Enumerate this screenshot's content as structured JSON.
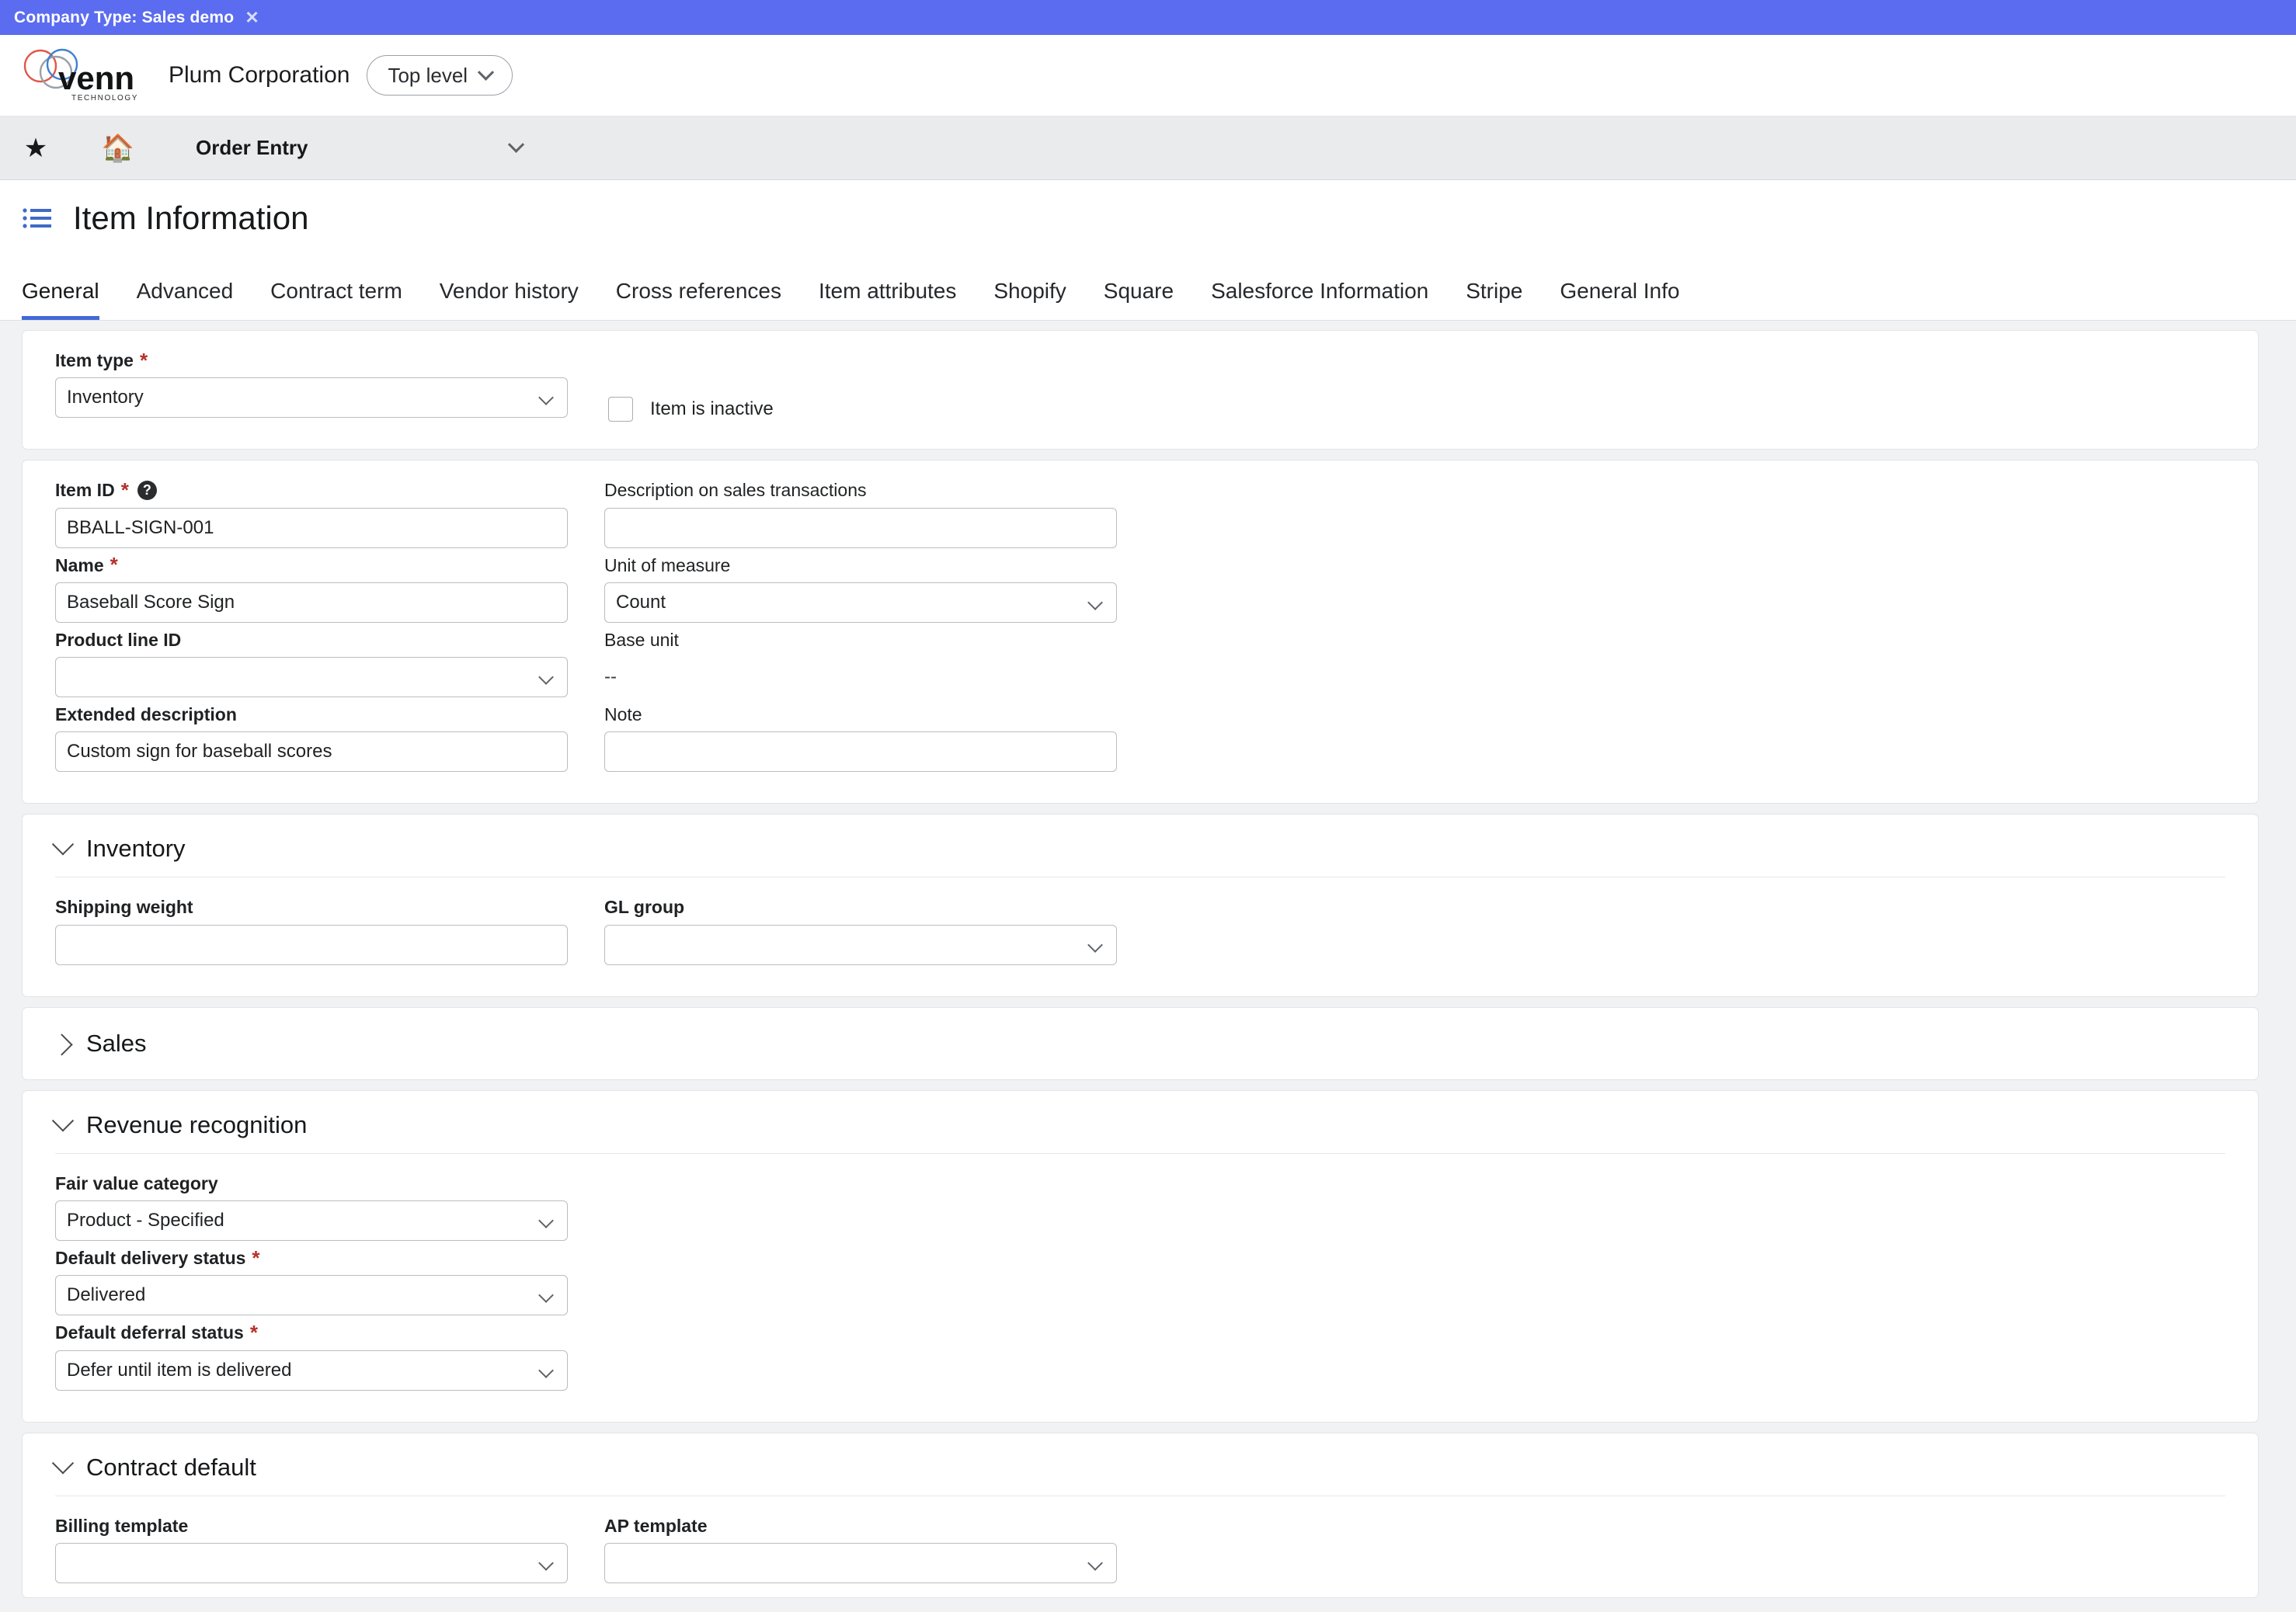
{
  "banner": {
    "text": "Company Type: Sales demo",
    "close_icon": "close-icon",
    "bg_color": "#5b6cf0"
  },
  "brand": {
    "logo_name": "venn-technology-logo",
    "logo_wordmark": "venn",
    "logo_subtext": "TECHNOLOGY",
    "company_name": "Plum Corporation",
    "scope_selector": "Top level"
  },
  "nav": {
    "favorite_icon": "star-icon",
    "home_icon": "home-icon",
    "module_title": "Order Entry",
    "dropdown_icon": "chevron-down-icon"
  },
  "page": {
    "list_icon": "list-icon",
    "title": "Item Information"
  },
  "tabs": [
    {
      "label": "General",
      "active": true
    },
    {
      "label": "Advanced",
      "active": false
    },
    {
      "label": "Contract term",
      "active": false
    },
    {
      "label": "Vendor history",
      "active": false
    },
    {
      "label": "Cross references",
      "active": false
    },
    {
      "label": "Item attributes",
      "active": false
    },
    {
      "label": "Shopify",
      "active": false
    },
    {
      "label": "Square",
      "active": false
    },
    {
      "label": "Salesforce Information",
      "active": false
    },
    {
      "label": "Stripe",
      "active": false
    },
    {
      "label": "General Info",
      "active": false
    }
  ],
  "item_type_card": {
    "item_type": {
      "label": "Item type",
      "required": true,
      "value": "Inventory"
    },
    "inactive": {
      "label": "Item is inactive",
      "checked": false
    }
  },
  "main_card": {
    "item_id": {
      "label": "Item ID",
      "required": true,
      "help_icon": "help-circle-icon",
      "value": "BBALL-SIGN-001"
    },
    "name": {
      "label": "Name",
      "required": true,
      "value": "Baseball Score Sign"
    },
    "product_line_id": {
      "label": "Product line ID",
      "value": ""
    },
    "extended_description": {
      "label": "Extended description",
      "value": "Custom sign for baseball scores"
    },
    "description_on_sales": {
      "label": "Description on sales transactions",
      "value": ""
    },
    "unit_of_measure": {
      "label": "Unit of measure",
      "value": "Count"
    },
    "base_unit": {
      "label": "Base unit",
      "value": "--"
    },
    "note": {
      "label": "Note",
      "value": ""
    }
  },
  "inventory_section": {
    "title": "Inventory",
    "expanded": true,
    "shipping_weight": {
      "label": "Shipping weight",
      "value": ""
    },
    "gl_group": {
      "label": "GL group",
      "value": ""
    }
  },
  "sales_section": {
    "title": "Sales",
    "expanded": false
  },
  "revenue_section": {
    "title": "Revenue recognition",
    "expanded": true,
    "fair_value_category": {
      "label": "Fair value category",
      "value": "Product - Specified"
    },
    "default_delivery_status": {
      "label": "Default delivery status",
      "required": true,
      "value": "Delivered"
    },
    "default_deferral_status": {
      "label": "Default deferral status",
      "required": true,
      "value": "Defer until item is delivered"
    }
  },
  "contract_section": {
    "title": "Contract default",
    "expanded": true,
    "billing_template": {
      "label": "Billing template",
      "value": ""
    },
    "ap_template": {
      "label": "AP template",
      "value": ""
    }
  },
  "colors": {
    "banner": "#5b6cf0",
    "tab_active_underline": "#4268d8",
    "required_asterisk": "#b3312c",
    "page_bg": "#f1f2f4",
    "card_bg": "#ffffff"
  }
}
